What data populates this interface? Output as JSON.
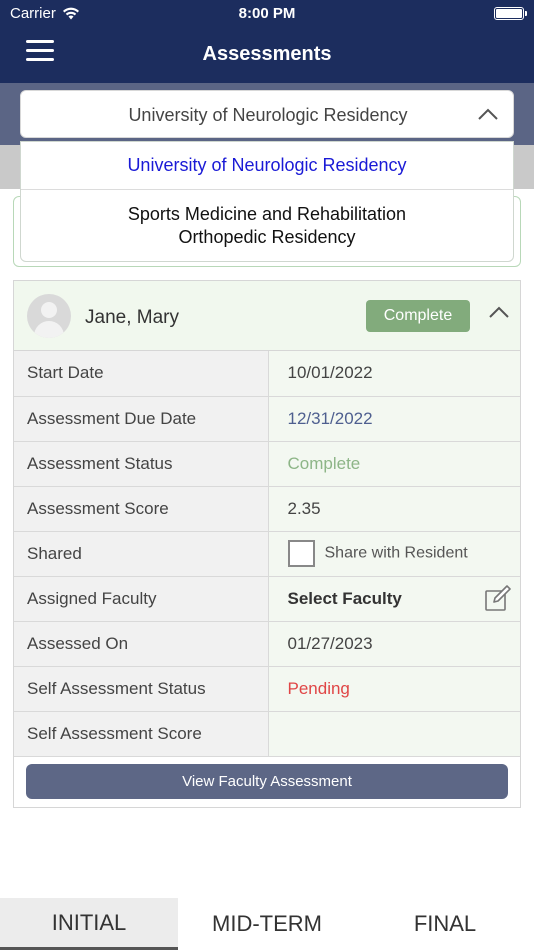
{
  "status_bar": {
    "carrier": "Carrier",
    "time": "8:00 PM"
  },
  "header": {
    "title": "Assessments",
    "menu_icon": "hamburger-menu-icon"
  },
  "program_select": {
    "selected": "University of Neurologic Residency",
    "options": [
      "University of Neurologic Residency",
      "Sports Medicine and Rehabilitation Orthopedic Residency"
    ],
    "option2_lines": [
      "Sports Medicine and Rehabilitation",
      "Orthopedic Residency"
    ]
  },
  "resident": {
    "name": "Jane, Mary",
    "status_badge": "Complete",
    "rows": [
      {
        "label": "Start Date",
        "value": "10/01/2022"
      },
      {
        "label": "Assessment Due Date",
        "value": "12/31/2022"
      },
      {
        "label": "Assessment Status",
        "value": "Complete"
      },
      {
        "label": "Assessment Score",
        "value": "2.35"
      },
      {
        "label": "Shared",
        "value": "Share with Resident"
      },
      {
        "label": "Assigned Faculty",
        "value": "Select Faculty"
      },
      {
        "label": "Assessed On",
        "value": "01/27/2023"
      },
      {
        "label": "Self Assessment Status",
        "value": "Pending"
      },
      {
        "label": "Self Assessment Score",
        "value": ""
      }
    ],
    "view_button": "View Faculty Assessment"
  },
  "tabs": [
    {
      "label": "INITIAL",
      "active": true
    },
    {
      "label": "MID-TERM",
      "active": false
    },
    {
      "label": "FINAL",
      "active": false
    }
  ],
  "colors": {
    "header_bg": "#1c2d5e",
    "accent_green": "#82ab7c",
    "pending_red": "#e04646",
    "link_blue": "#1a1ad6"
  }
}
